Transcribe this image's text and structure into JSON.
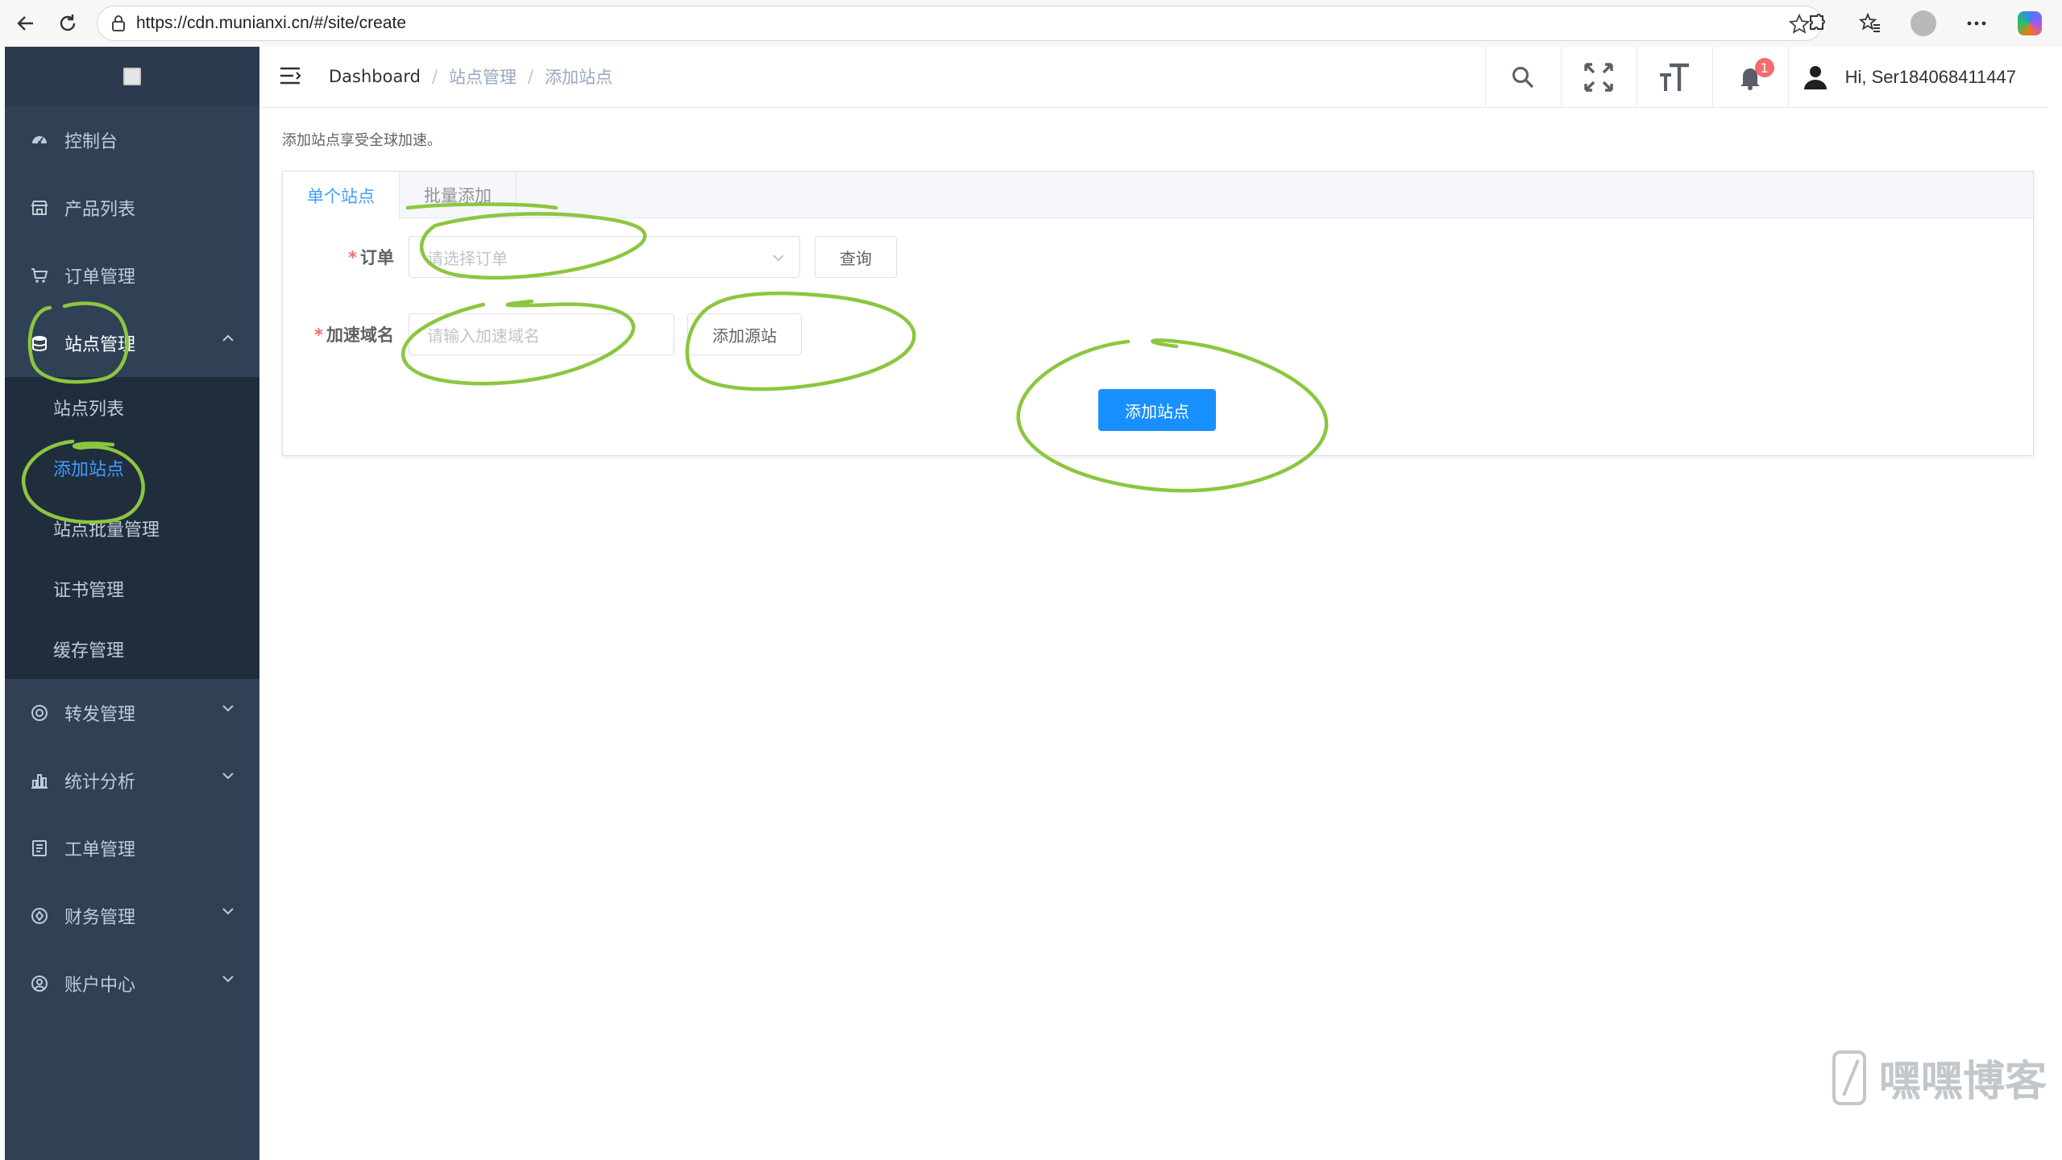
{
  "browser": {
    "url": "https://cdn.munianxi.cn/#/site/create"
  },
  "sidebar": {
    "items": [
      {
        "label": "控制台",
        "icon": "dashboard-icon"
      },
      {
        "label": "产品列表",
        "icon": "store-icon"
      },
      {
        "label": "订单管理",
        "icon": "cart-icon"
      },
      {
        "label": "站点管理",
        "icon": "database-icon",
        "expanded": true,
        "children": [
          "站点列表",
          "添加站点",
          "站点批量管理",
          "证书管理",
          "缓存管理"
        ],
        "active_child": "添加站点"
      },
      {
        "label": "转发管理",
        "icon": "target-icon"
      },
      {
        "label": "统计分析",
        "icon": "bar-chart-icon"
      },
      {
        "label": "工单管理",
        "icon": "document-icon"
      },
      {
        "label": "财务管理",
        "icon": "finance-icon"
      },
      {
        "label": "账户中心",
        "icon": "user-circle-icon"
      }
    ]
  },
  "header": {
    "breadcrumb": [
      "Dashboard",
      "站点管理",
      "添加站点"
    ],
    "notification_count": "1",
    "greeting": "Hi, Ser184068411447"
  },
  "content": {
    "notice": "添加站点享受全球加速。",
    "tabs": [
      "单个站点",
      "批量添加"
    ],
    "active_tab": "单个站点",
    "order_label": "订单",
    "order_placeholder": "请选择订单",
    "query_button": "查询",
    "domain_label": "加速域名",
    "domain_placeholder": "请输入加速域名",
    "add_origin_button": "添加源站",
    "submit_button": "添加站点"
  },
  "watermark": {
    "text": "嘿嘿博客"
  },
  "colors": {
    "sidebar_bg": "#304156",
    "submenu_bg": "#1f2d3d",
    "active": "#409eff",
    "primary_button": "#1890ff",
    "annotation": "#8cc63f"
  }
}
